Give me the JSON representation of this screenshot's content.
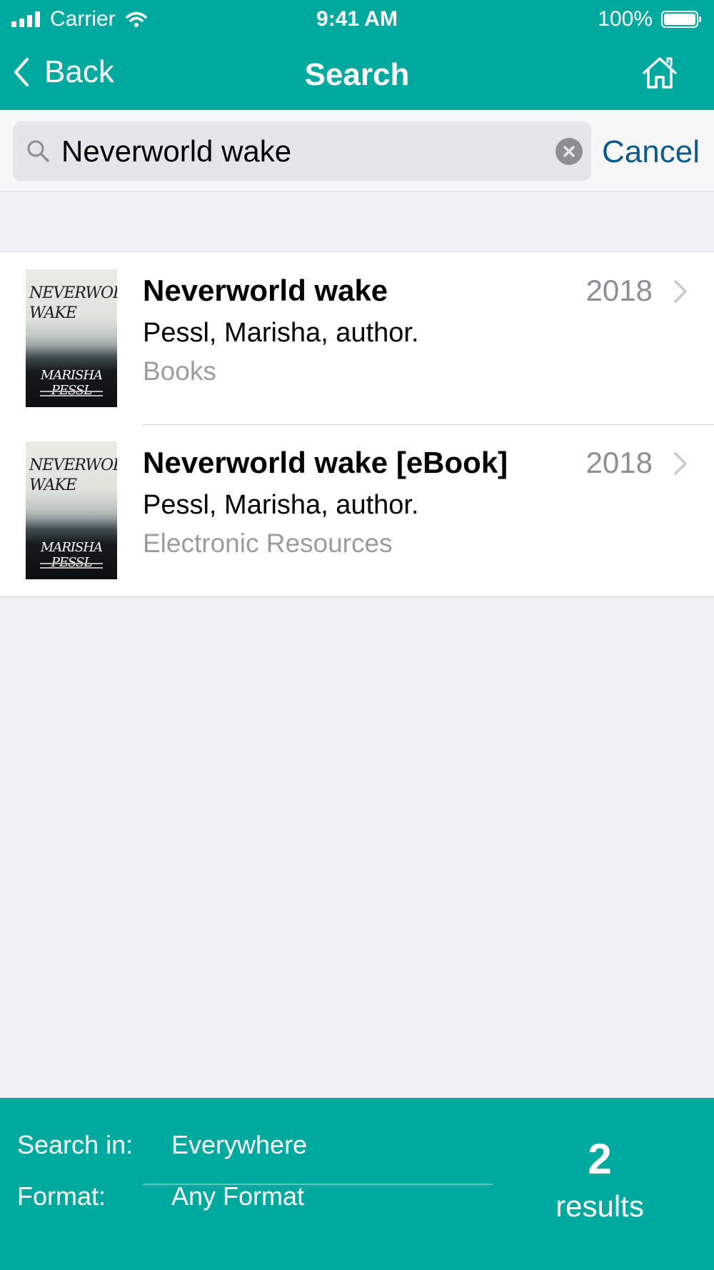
{
  "status_bar": {
    "carrier": "Carrier",
    "time": "9:41 AM",
    "battery": "100%"
  },
  "nav": {
    "back_label": "Back",
    "title": "Search"
  },
  "search": {
    "value": "Neverworld wake",
    "cancel_label": "Cancel"
  },
  "results": [
    {
      "title": "Neverworld wake",
      "year": "2018",
      "author": "Pessl, Marisha, author.",
      "format": "Books",
      "cover_title": "NEVERWORLD WAKE",
      "cover_author": "MARISHA PESSL"
    },
    {
      "title": "Neverworld wake [eBook]",
      "year": "2018",
      "author": "Pessl, Marisha, author.",
      "format": "Electronic Resources",
      "cover_title": "NEVERWORLD WAKE",
      "cover_author": "MARISHA PESSL"
    }
  ],
  "footer": {
    "search_in_label": "Search in:",
    "search_in_value": "Everywhere",
    "format_label": "Format:",
    "format_value": "Any Format",
    "results_count": "2",
    "results_word": "results"
  },
  "colors": {
    "brand": "#00a99d",
    "link": "#0a5a8c",
    "background": "#efeff4"
  },
  "icons": {
    "back": "chevron-left-icon",
    "home": "home-icon",
    "search": "search-icon",
    "clear": "clear-icon",
    "row_chevron": "chevron-right-icon"
  }
}
